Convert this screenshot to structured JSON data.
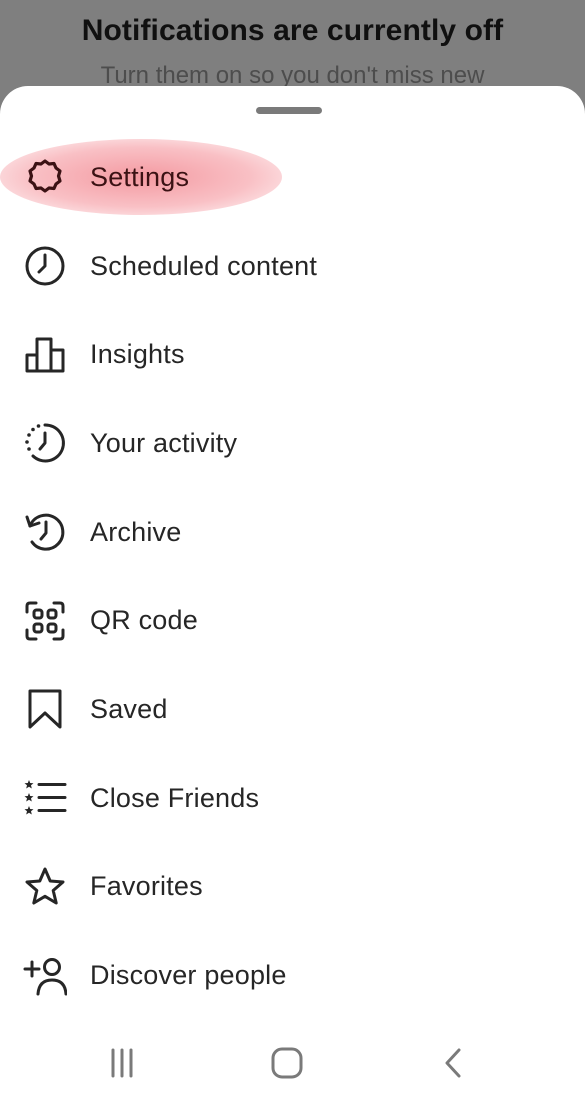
{
  "backdrop": {
    "title": "Notifications are currently off",
    "subtitle": "Turn them on so you don't miss new"
  },
  "menu": {
    "items": [
      {
        "label": "Settings",
        "icon": "settings-icon"
      },
      {
        "label": "Scheduled content",
        "icon": "clock-icon"
      },
      {
        "label": "Insights",
        "icon": "bar-chart-icon"
      },
      {
        "label": "Your activity",
        "icon": "activity-icon"
      },
      {
        "label": "Archive",
        "icon": "archive-icon"
      },
      {
        "label": "QR code",
        "icon": "qr-code-icon"
      },
      {
        "label": "Saved",
        "icon": "bookmark-icon"
      },
      {
        "label": "Close Friends",
        "icon": "close-friends-icon"
      },
      {
        "label": "Favorites",
        "icon": "star-icon"
      },
      {
        "label": "Discover people",
        "icon": "add-person-icon"
      }
    ]
  },
  "navbar": {
    "recents_icon": "recents-icon",
    "home_icon": "home-icon",
    "back_icon": "back-icon"
  },
  "colors": {
    "highlight": "#f07882",
    "text": "#262626",
    "backdrop": "#7f7f7f"
  }
}
